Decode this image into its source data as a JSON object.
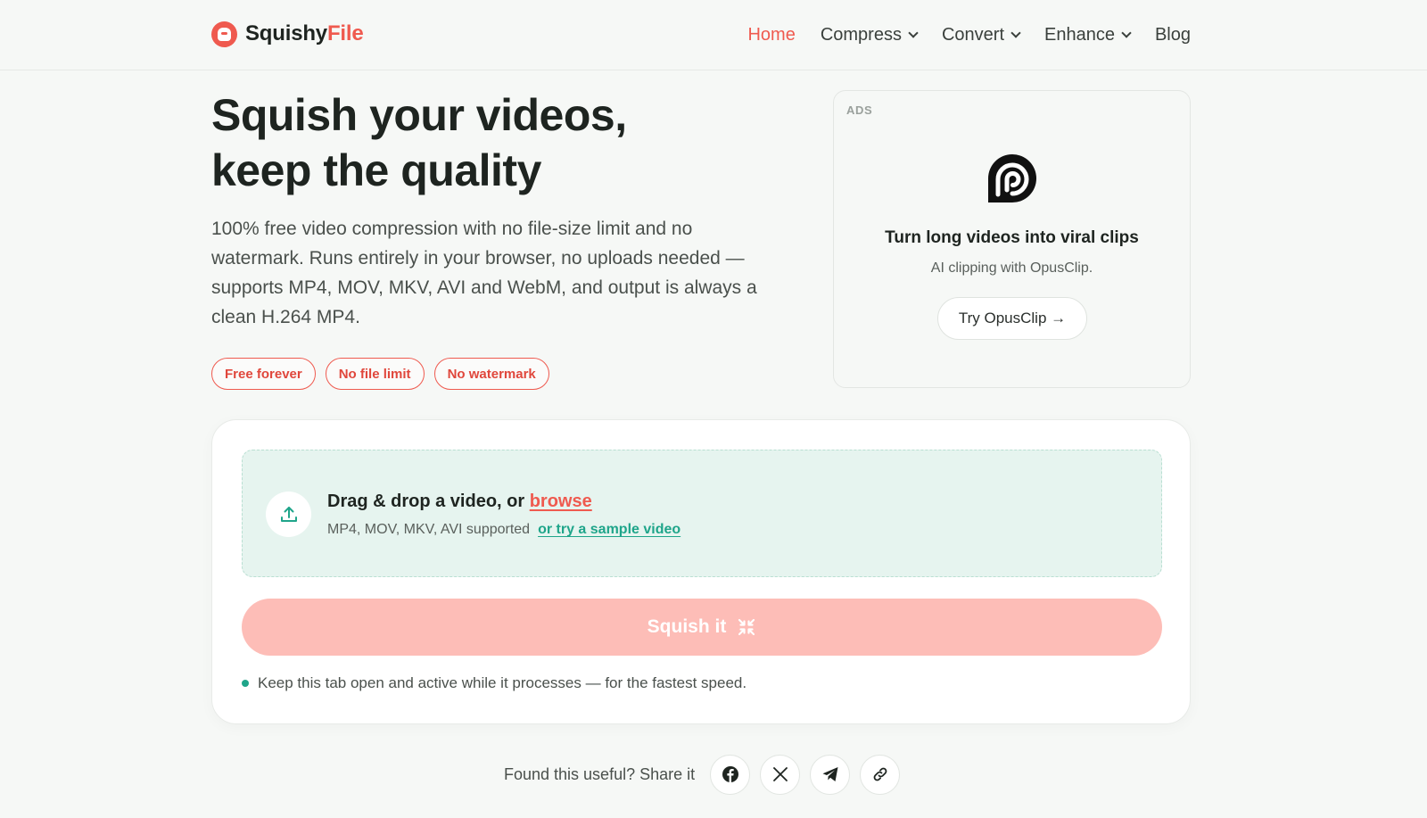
{
  "header": {
    "brand": {
      "part1": "Squishy",
      "part2": "File"
    },
    "nav": [
      {
        "label": "Home",
        "active": true,
        "has_dropdown": false
      },
      {
        "label": "Compress",
        "active": false,
        "has_dropdown": true
      },
      {
        "label": "Convert",
        "active": false,
        "has_dropdown": true
      },
      {
        "label": "Enhance",
        "active": false,
        "has_dropdown": true
      },
      {
        "label": "Blog",
        "active": false,
        "has_dropdown": false
      }
    ]
  },
  "hero": {
    "title_line1": "Squish your videos,",
    "title_line2": "keep the quality",
    "subtitle": "100% free video compression with no file-size limit and no watermark. Runs entirely in your browser, no uploads needed — supports MP4, MOV, MKV, AVI and WebM, and output is always a clean H.264 MP4.",
    "pills": [
      "Free forever",
      "No file limit",
      "No watermark"
    ]
  },
  "ad": {
    "label": "ADS",
    "title": "Turn long videos into viral clips",
    "description": "AI clipping with OpusClip.",
    "button": "Try OpusClip →"
  },
  "upload": {
    "title_prefix": "Drag & drop a video, or ",
    "browse_label": "browse",
    "formats": "MP4, MOV, MKV, AVI supported",
    "sample_link": "or try a sample video",
    "submit_label": "Squish it",
    "note": "Keep this tab open and active while it processes — for the fastest speed."
  },
  "share": {
    "label": "Found this useful? Share it",
    "buttons": [
      "facebook-icon",
      "x-icon",
      "telegram-icon",
      "link-icon"
    ]
  },
  "colors": {
    "accent": "#ef5a4f",
    "teal": "#1fa58a",
    "button_disabled": "#fdbdb7"
  }
}
